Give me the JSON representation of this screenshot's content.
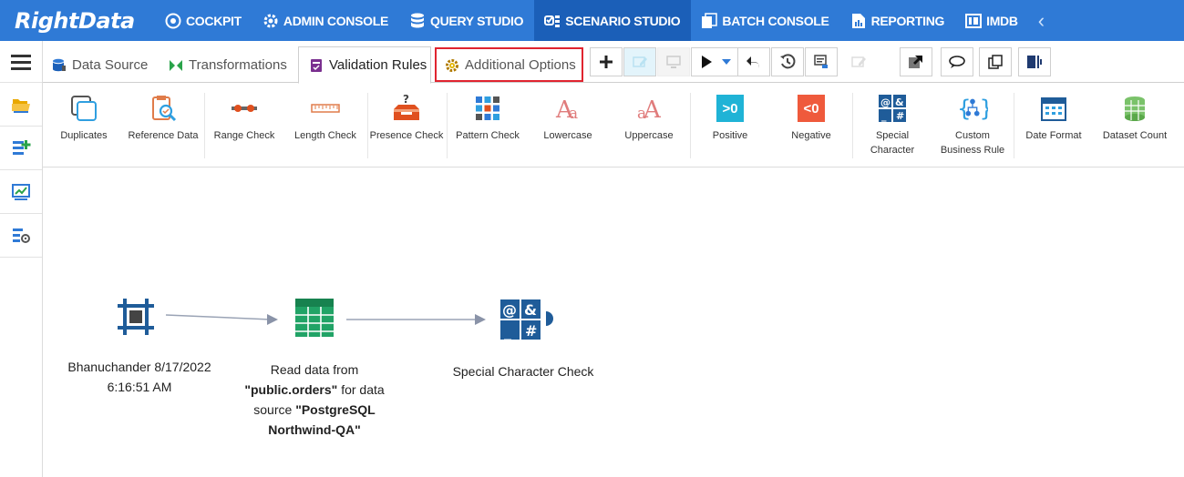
{
  "app": {
    "logo_text": "RightData"
  },
  "topnav": {
    "items": [
      {
        "label": "COCKPIT",
        "icon": "cockpit-icon"
      },
      {
        "label": "ADMIN CONSOLE",
        "icon": "gear-icon"
      },
      {
        "label": "QUERY STUDIO",
        "icon": "database-icon"
      },
      {
        "label": "SCENARIO STUDIO",
        "icon": "scenario-icon",
        "active": true
      },
      {
        "label": "BATCH CONSOLE",
        "icon": "batch-icon"
      },
      {
        "label": "REPORTING",
        "icon": "report-icon"
      },
      {
        "label": "IMDB",
        "icon": "imdb-icon"
      }
    ]
  },
  "tabs": [
    {
      "label": "Data Source",
      "icon": "datasource-icon"
    },
    {
      "label": "Transformations",
      "icon": "transform-icon"
    },
    {
      "label": "Validation Rules",
      "icon": "validation-icon",
      "active": true
    },
    {
      "label": "Additional Options",
      "icon": "gear-icon",
      "highlighted": true
    }
  ],
  "ribbon": [
    {
      "label": "Duplicates",
      "icon": "duplicates-icon"
    },
    {
      "label": "Reference Data",
      "icon": "reference-data-icon"
    },
    {
      "label": "Range Check",
      "icon": "range-check-icon"
    },
    {
      "label": "Length Check",
      "icon": "length-check-icon"
    },
    {
      "label": "Presence Check",
      "icon": "presence-check-icon"
    },
    {
      "label": "Pattern Check",
      "icon": "pattern-check-icon"
    },
    {
      "label": "Lowercase",
      "icon": "lowercase-icon"
    },
    {
      "label": "Uppercase",
      "icon": "uppercase-icon"
    },
    {
      "label": "Positive",
      "icon": "positive-icon",
      "glyph": ">0"
    },
    {
      "label": "Negative",
      "icon": "negative-icon",
      "glyph": "<0"
    },
    {
      "label": "Special Character",
      "icon": "special-character-icon"
    },
    {
      "label": "Custom Business Rule",
      "icon": "custom-rule-icon"
    },
    {
      "label": "Date Format",
      "icon": "date-format-icon"
    },
    {
      "label": "Dataset Count",
      "icon": "dataset-count-icon"
    }
  ],
  "canvas": {
    "nodes": [
      {
        "label_line1": "Bhanuchander 8/17/2022",
        "label_line2": "6:16:51 AM",
        "icon": "scenario-start-icon"
      },
      {
        "label_pre": "Read data from",
        "label_b1": "\"public.orders\"",
        "label_mid": "for data source",
        "label_b2": "\"PostgreSQL Northwind-QA\"",
        "icon": "table-icon"
      },
      {
        "label": "Special Character Check",
        "icon": "special-character-icon"
      }
    ]
  },
  "colors": {
    "nav_bg": "#2f7ad6",
    "nav_active": "#1b5fb8",
    "highlight": "#e0242f",
    "node_blue": "#1f5c99",
    "node_green": "#21a366"
  }
}
